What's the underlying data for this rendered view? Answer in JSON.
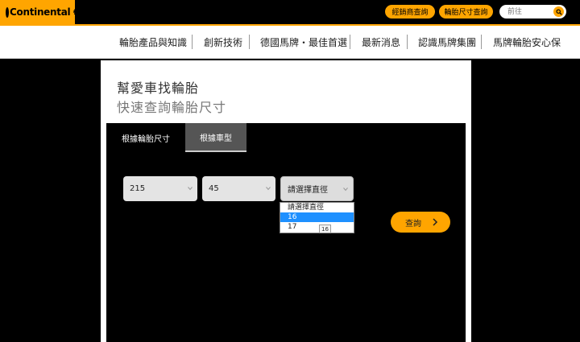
{
  "header": {
    "logo_text": "Continental",
    "dealer_button": "經銷商查詢",
    "tire_size_button": "輪胎尺寸查詢",
    "search_placeholder": "前往",
    "brand_color": "#ffa500"
  },
  "nav": {
    "items": [
      {
        "label": "輪胎產品與知識"
      },
      {
        "label": "創新技術"
      },
      {
        "label": "德國馬牌・最佳首選"
      },
      {
        "label": "最新消息"
      },
      {
        "label": "認識馬牌集團"
      },
      {
        "label": "馬牌輪胎安心保"
      }
    ]
  },
  "main": {
    "title": "幫愛車找輪胎",
    "subtitle": "快速查詢輪胎尺寸",
    "tabs": [
      {
        "label": "根據輪胎尺寸",
        "active": true
      },
      {
        "label": "根據車型",
        "active": false
      }
    ],
    "selects": {
      "width": "215",
      "ratio": "45",
      "rim": "請選擇直徑"
    },
    "rim_options": [
      "請選擇直徑",
      "16",
      "17"
    ],
    "highlighted_option": "16",
    "tooltip": "16",
    "query_button": "查詢"
  }
}
